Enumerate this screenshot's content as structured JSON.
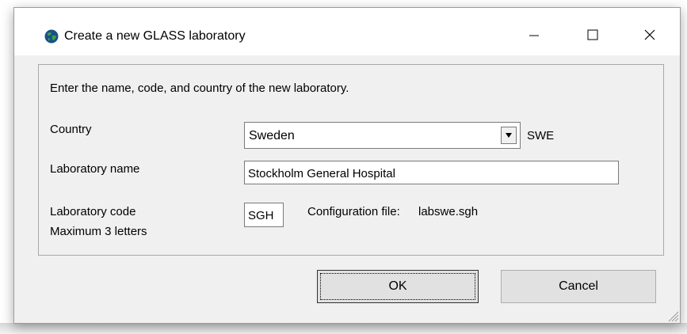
{
  "window": {
    "title": "Create a new GLASS laboratory",
    "controls": {
      "minimize": "—",
      "maximize": "☐",
      "close": "✕"
    }
  },
  "form": {
    "instructions": "Enter the name, code, and country of the new laboratory.",
    "country_label": "Country",
    "country_value": "Sweden",
    "country_code": "SWE",
    "lab_name_label": "Laboratory name",
    "lab_name_value": "Stockholm General Hospital",
    "lab_code_label": "Laboratory code",
    "lab_code_hint": "Maximum 3 letters",
    "lab_code_value": "SGH",
    "config_file_label": "Configuration file:",
    "config_file_value": "labswe.sgh"
  },
  "buttons": {
    "ok": "OK",
    "cancel": "Cancel"
  },
  "colors": {
    "dialog_bg": "#f0f0f0",
    "titlebar_bg": "#ffffff",
    "button_bg": "#e1e1e1"
  }
}
